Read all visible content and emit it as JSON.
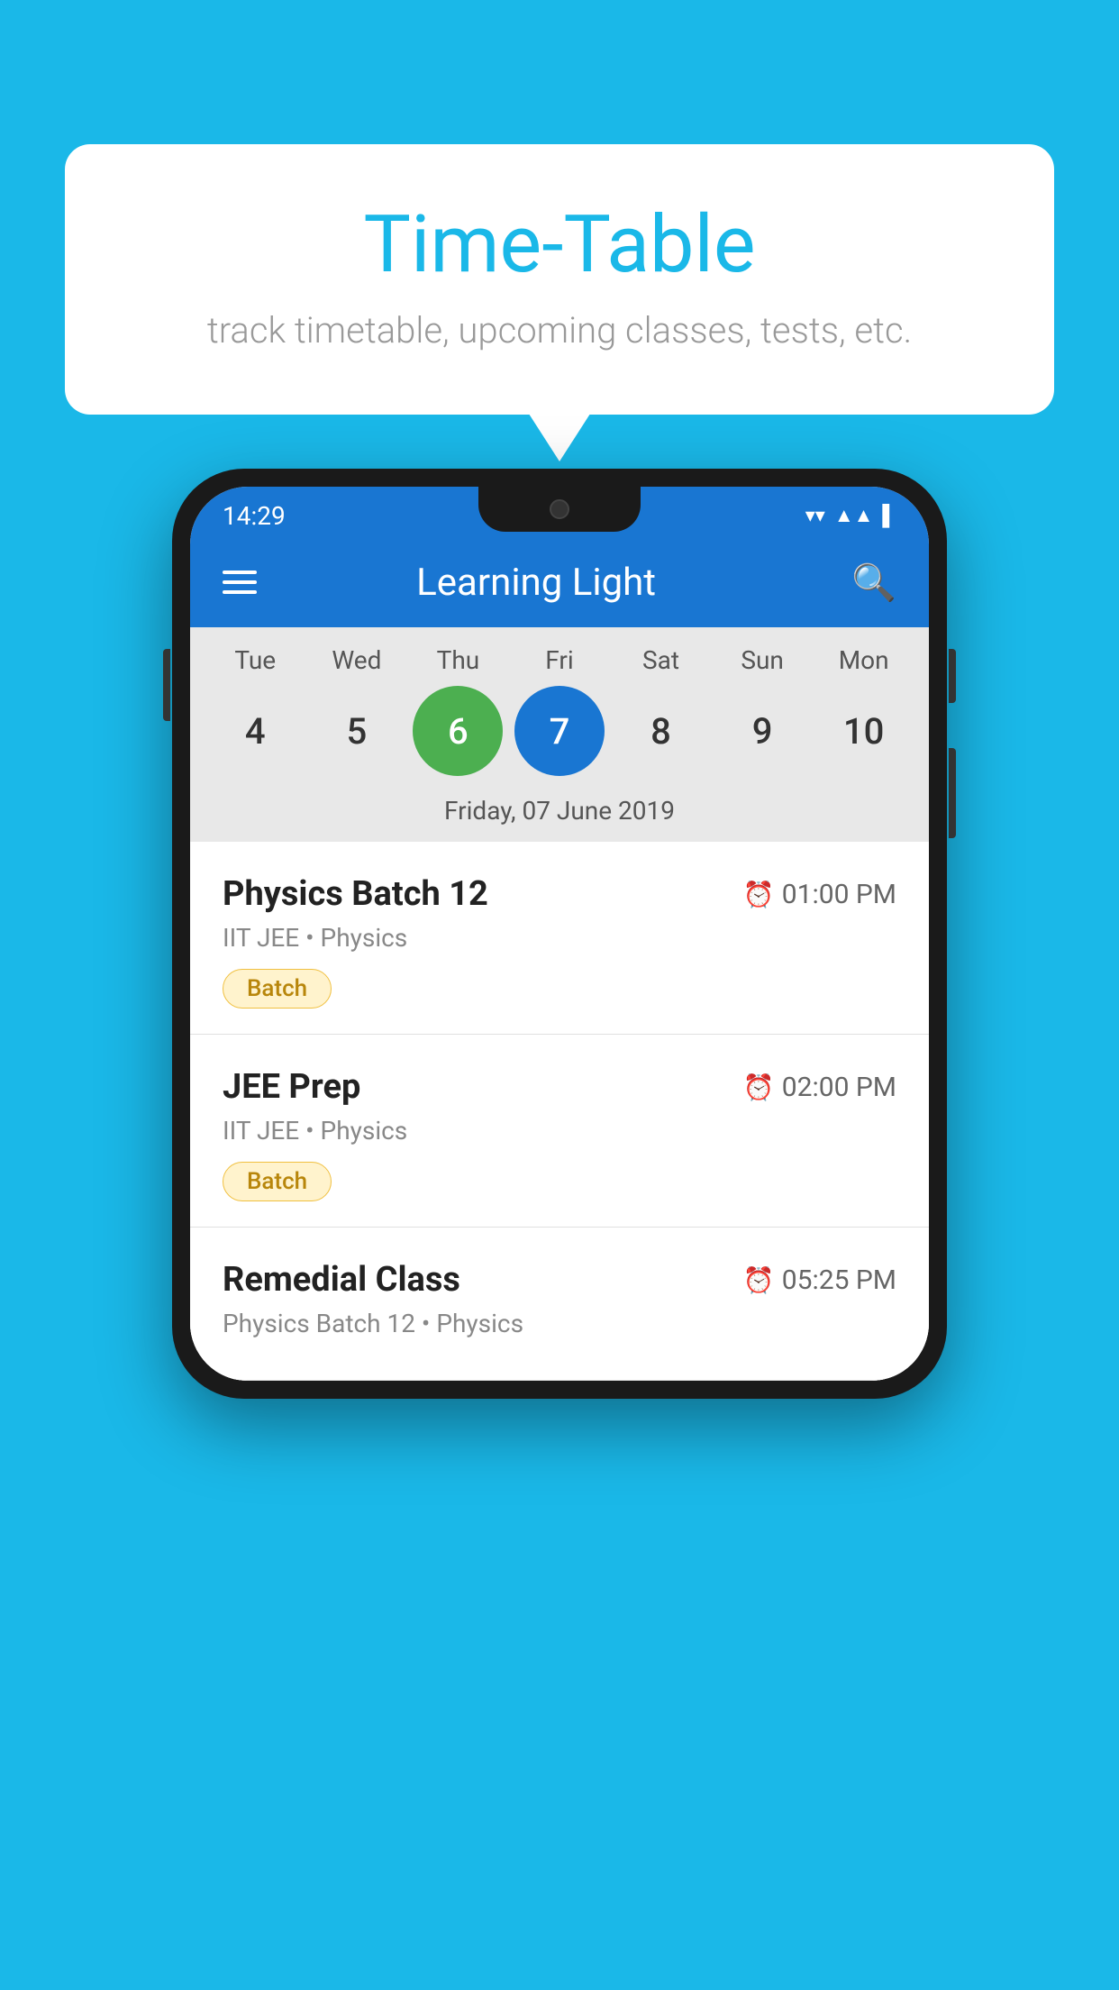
{
  "background_color": "#1ab8e8",
  "bubble": {
    "title": "Time-Table",
    "subtitle": "track timetable, upcoming classes, tests, etc."
  },
  "phone": {
    "status_bar": {
      "time": "14:29"
    },
    "header": {
      "app_name": "Learning Light"
    },
    "calendar": {
      "days": [
        {
          "label": "Tue",
          "num": "4"
        },
        {
          "label": "Wed",
          "num": "5"
        },
        {
          "label": "Thu",
          "num": "6",
          "state": "today"
        },
        {
          "label": "Fri",
          "num": "7",
          "state": "selected"
        },
        {
          "label": "Sat",
          "num": "8"
        },
        {
          "label": "Sun",
          "num": "9"
        },
        {
          "label": "Mon",
          "num": "10"
        }
      ],
      "selected_date": "Friday, 07 June 2019"
    },
    "schedule": [
      {
        "title": "Physics Batch 12",
        "time": "01:00 PM",
        "subtitle": "IIT JEE • Physics",
        "badge": "Batch"
      },
      {
        "title": "JEE Prep",
        "time": "02:00 PM",
        "subtitle": "IIT JEE • Physics",
        "badge": "Batch"
      },
      {
        "title": "Remedial Class",
        "time": "05:25 PM",
        "subtitle": "Physics Batch 12 • Physics",
        "badge": null
      }
    ]
  }
}
